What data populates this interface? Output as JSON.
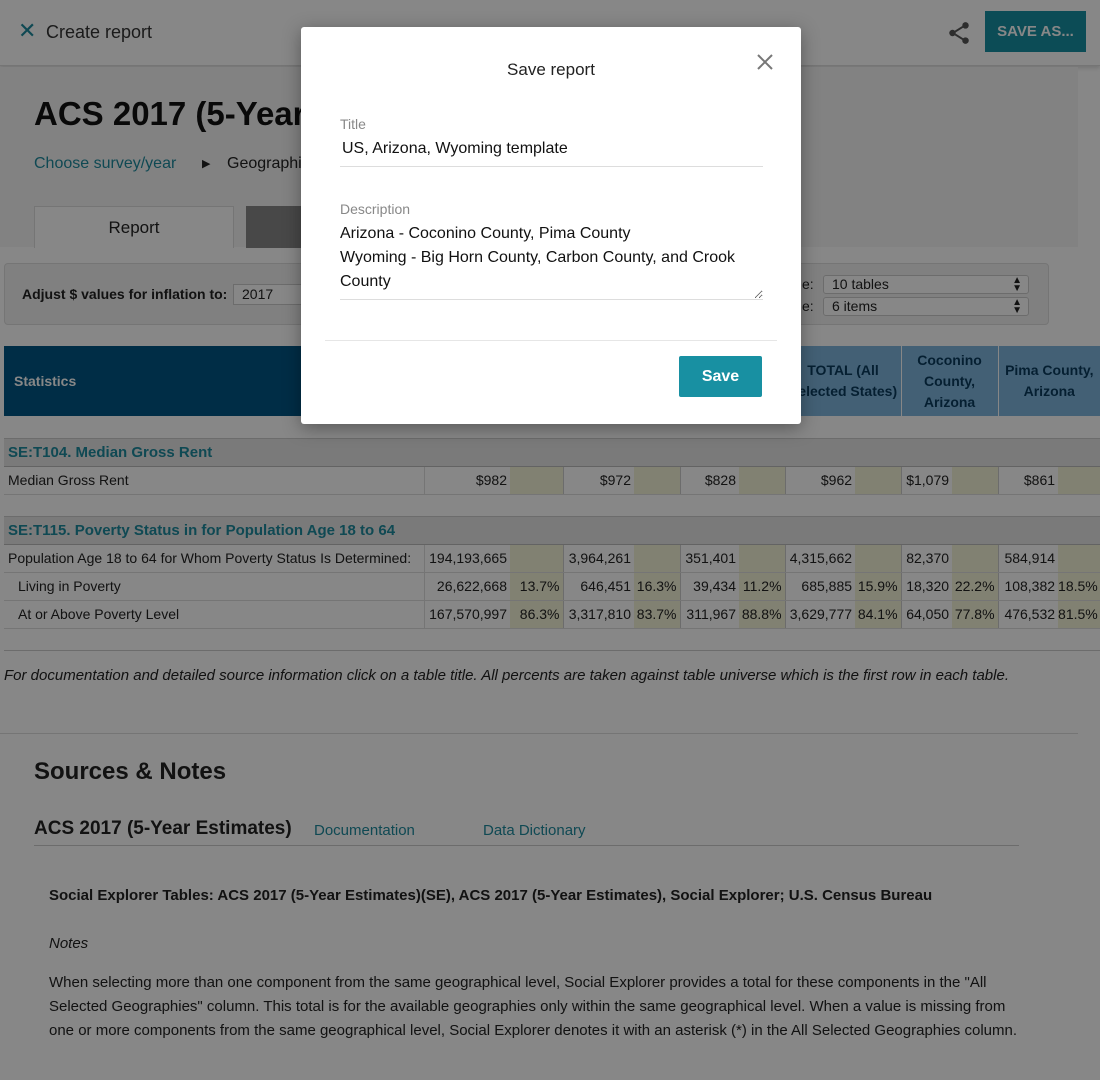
{
  "topbar": {
    "title": "Create report",
    "save_as_label": "SAVE AS..."
  },
  "hero": {
    "page_title": "ACS 2017 (5-Year",
    "breadcrumb_link": "Choose survey/year",
    "breadcrumb_geo": "Geographi",
    "tab_report": "Report"
  },
  "controls": {
    "inflation_label": "Adjust $ values for inflation to:",
    "inflation_value": "2017",
    "select1_label": "e:",
    "select1_value": "10 tables",
    "select2_label": "e:",
    "select2_value": "6 items"
  },
  "table": {
    "stats_header": "Statistics",
    "visible_headers": [
      "TOTAL (All Selected States)",
      "Coconino County, Arizona",
      "Pima County, Arizona"
    ],
    "section1": {
      "title": "SE:T104. Median Gross Rent",
      "row_label": "Median Gross Rent",
      "values": [
        "$982",
        "$972",
        "$828",
        "$962",
        "$1,079",
        "$861"
      ]
    },
    "section2": {
      "title": "SE:T115. Poverty Status in for Population Age 18 to 64",
      "rows": [
        {
          "label": "Population Age 18 to 64 for Whom Poverty Status Is Determined:",
          "values": [
            "194,193,665",
            "3,964,261",
            "351,401",
            "4,315,662",
            "82,370",
            "584,914"
          ],
          "pcts": [
            "",
            "",
            "",
            "",
            "",
            ""
          ]
        },
        {
          "label": "Living in Poverty",
          "values": [
            "26,622,668",
            "646,451",
            "39,434",
            "685,885",
            "18,320",
            "108,382"
          ],
          "pcts": [
            "13.7%",
            "16.3%",
            "11.2%",
            "15.9%",
            "22.2%",
            "18.5%"
          ]
        },
        {
          "label": "At or Above Poverty Level",
          "values": [
            "167,570,997",
            "3,317,810",
            "311,967",
            "3,629,777",
            "64,050",
            "476,532"
          ],
          "pcts": [
            "86.3%",
            "83.7%",
            "88.8%",
            "84.1%",
            "77.8%",
            "81.5%"
          ]
        }
      ]
    }
  },
  "doc_note": "For documentation and detailed source information click on a table title.  All percents are taken against table universe which is the first row in each table.",
  "sources": {
    "title": "Sources & Notes",
    "survey_title": "ACS 2017 (5-Year Estimates)",
    "link_documentation": "Documentation",
    "link_dictionary": "Data Dictionary",
    "source_line": "Social Explorer Tables: ACS 2017 (5-Year Estimates)(SE), ACS 2017 (5-Year Estimates), Social Explorer; U.S. Census Bureau",
    "notes_label": "Notes",
    "notes_text": "When selecting more than one component from the same geographical level, Social Explorer provides a total for these components in the \"All Selected Geographies\" column. This total is for the available geographies only within the same geographical level. When a value is missing from one or more components from the same geographical level, Social Explorer denotes it with an asterisk (*) in the All Selected Geographies column."
  },
  "modal": {
    "title": "Save report",
    "title_label": "Title",
    "title_value": "US, Arizona, Wyoming template",
    "description_label": "Description",
    "description_value": "Arizona - Coconino County, Pima County\nWyoming - Big Horn County, Carbon County, and Crook County",
    "save_label": "Save"
  },
  "colors": {
    "accent": "#1890a2",
    "link": "#1e8a9e",
    "table_header_dark": "#005684",
    "table_header_light": "#7fb5de",
    "pct_cell": "#f3f3d8"
  }
}
